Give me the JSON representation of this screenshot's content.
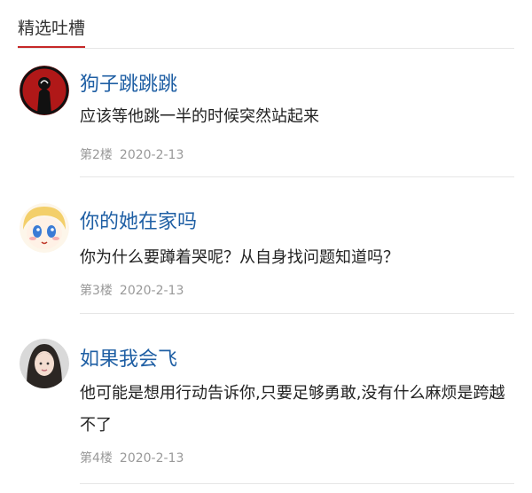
{
  "header": {
    "title": "精选吐槽"
  },
  "comments": [
    {
      "user": "狗子跳跳跳",
      "text": "应该等他跳一半的时候突然站起来",
      "floor": "第2楼",
      "date": "2020-2-13",
      "avatar": "dark-figure-avatar"
    },
    {
      "user": "你的她在家吗",
      "text": "你为什么要蹲着哭呢？从自身找问题知道吗？",
      "floor": "第3楼",
      "date": "2020-2-13",
      "avatar": "anime-girl-avatar"
    },
    {
      "user": "如果我会飞",
      "text": "他可能是想用行动告诉你,只要足够勇敢,没有什么麻烦是跨越不了",
      "floor": "第4楼",
      "date": "2020-2-13",
      "avatar": "woman-photo-avatar"
    }
  ],
  "colors": {
    "username": "#1f5fa4",
    "accent": "#c62828",
    "meta": "#999999"
  }
}
